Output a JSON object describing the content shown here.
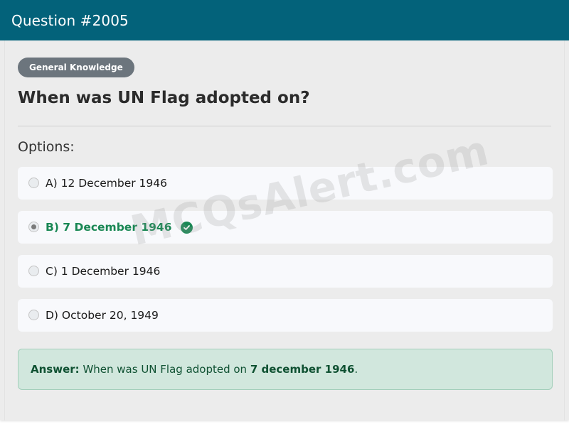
{
  "header": {
    "title": "Question #2005"
  },
  "category": "General Knowledge",
  "question": "When was UN Flag adopted on?",
  "options_label": "Options:",
  "options": [
    {
      "label": "A) 12 December 1946",
      "selected": false,
      "correct": false
    },
    {
      "label": "B) 7 December 1946",
      "selected": true,
      "correct": true
    },
    {
      "label": "C) 1 December 1946",
      "selected": false,
      "correct": false
    },
    {
      "label": "D) October 20, 1949",
      "selected": false,
      "correct": false
    }
  ],
  "answer": {
    "prefix": "Answer:",
    "text": "When was UN Flag adopted on",
    "value": "7 december 1946",
    "suffix": "."
  },
  "watermark": "MCQsAlert.com",
  "colors": {
    "header": "#03627a",
    "correct": "#198754",
    "answer_bg": "#d1e7dd"
  }
}
